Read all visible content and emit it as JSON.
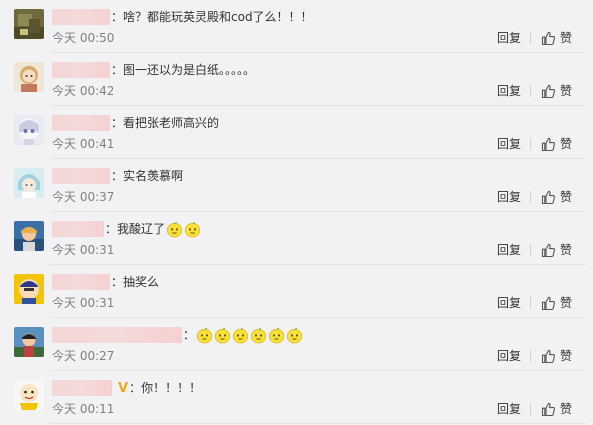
{
  "comments": [
    {
      "time": "今天 00:50",
      "text": "：啥？都能玩英灵殿和cod了么！！！",
      "emoji_count": 0,
      "verified": false,
      "verified_badge": "",
      "reply_label": "回复",
      "like_label": "赞"
    },
    {
      "time": "今天 00:42",
      "text": "：图一还以为是白纸。。。。。",
      "emoji_count": 0,
      "verified": false,
      "verified_badge": "",
      "reply_label": "回复",
      "like_label": "赞"
    },
    {
      "time": "今天 00:41",
      "text": "：看把张老师高兴的",
      "emoji_count": 0,
      "verified": false,
      "verified_badge": "",
      "reply_label": "回复",
      "like_label": "赞"
    },
    {
      "time": "今天 00:37",
      "text": "：实名羡慕啊",
      "emoji_count": 0,
      "verified": false,
      "verified_badge": "",
      "reply_label": "回复",
      "like_label": "赞"
    },
    {
      "time": "今天 00:31",
      "text": "：我酸辽了",
      "emoji_count": 2,
      "verified": false,
      "verified_badge": "",
      "reply_label": "回复",
      "like_label": "赞"
    },
    {
      "time": "今天 00:31",
      "text": "：抽奖么",
      "emoji_count": 0,
      "verified": false,
      "verified_badge": "",
      "reply_label": "回复",
      "like_label": "赞"
    },
    {
      "time": "今天 00:27",
      "text": "：",
      "emoji_count": 6,
      "verified": false,
      "verified_badge": "",
      "reply_label": "回复",
      "like_label": "赞"
    },
    {
      "time": "今天 00:11",
      "text": "：你！！！！",
      "emoji_count": 0,
      "verified": true,
      "verified_badge": "V",
      "reply_label": "回复",
      "like_label": "赞"
    }
  ],
  "icons": {
    "like": "thumbs-up-icon",
    "emoji": "lemon-emoji-icon",
    "verified": "verified-badge-icon"
  },
  "colors": {
    "background": "#f2f2f5",
    "text": "#333333",
    "time": "#808080",
    "blurred_username": "#f5d6d6",
    "verified_badge": "#f2a516",
    "emoji_fill": "#f7e23a"
  }
}
